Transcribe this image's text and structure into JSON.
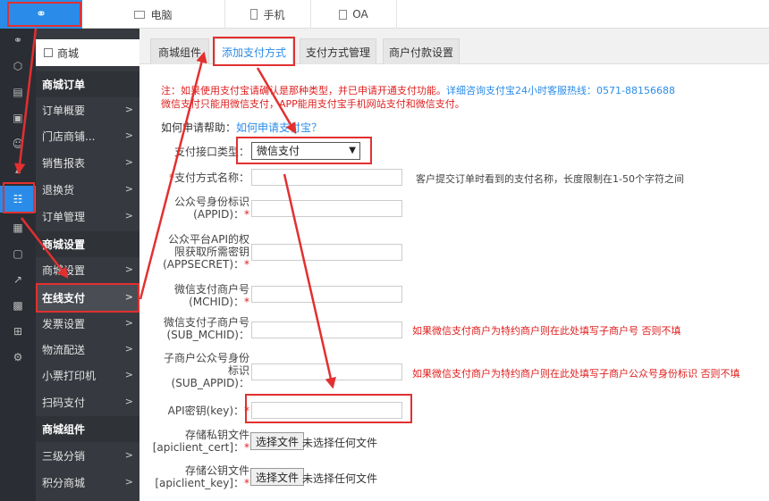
{
  "topbar": {
    "logo_glyph": "&#8734;",
    "tabs": [
      {
        "label": "电脑",
        "icon": "monitor-icon"
      },
      {
        "label": "手机",
        "icon": "phone-icon"
      },
      {
        "label": "OA",
        "icon": "document-icon"
      }
    ]
  },
  "rail": {
    "icons": [
      "link-icon",
      "cube-icon",
      "document-icon",
      "image-icon",
      "user-icon",
      "chart-icon",
      "clipboard-icon",
      "shop-icon",
      "briefcase-icon",
      "trend-icon",
      "id-card-icon",
      "grid-icon",
      "gear-icon"
    ]
  },
  "menu": {
    "store": "商城",
    "sections": [
      {
        "header": "商城订单",
        "items": [
          "订单概要",
          "门店商铺...",
          "销售报表",
          "退换货",
          "订单管理"
        ]
      },
      {
        "header": "商城设置",
        "items": [
          "商城设置",
          "在线支付",
          "发票设置",
          "物流配送",
          "小票打印机",
          "扫码支付"
        ]
      },
      {
        "header": "商城组件",
        "items": [
          "三级分销",
          "积分商城"
        ]
      }
    ]
  },
  "tabs": [
    "商城组件",
    "添加支付方式",
    "支付方式管理",
    "商户付款设置"
  ],
  "notice": {
    "line1_red": "注：如果使用支付宝请确认是那种类型，并已申请开通支付功能。",
    "line1_blue": "详细咨询支付宝24小时客服热线：0571-88156688",
    "line2": "微信支付只能用微信支付，APP能用支付宝手机网站支付和微信支付。"
  },
  "help": {
    "label": "如何申请帮助：",
    "link": "如何申请支付宝？"
  },
  "form": {
    "type_label": "支付接口类型：",
    "type_value": "微信支付",
    "name_label": "支付方式名称：",
    "name_hint": "客户提交订单时看到的支付名称，长度限制在1-50个字符之间",
    "appid_label1": "公众号身份标识",
    "appid_label2": "(APPID)：",
    "secret_label1": "公众平台API的权",
    "secret_label2": "限获取所需密钥",
    "secret_label3": "(APPSECRET)：",
    "mchid_label1": "微信支付商户号",
    "mchid_label2": "(MCHID)：",
    "sub_mchid_label1": "微信支付子商户号",
    "sub_mchid_label2": "(SUB_MCHID)：",
    "sub_mchid_hint": "如果微信支付商户为特约商户则在此处填写子商户号 否则不填",
    "sub_appid_label1": "子商户公众号身份",
    "sub_appid_label2": "标识",
    "sub_appid_label3": "(SUB_APPID)：",
    "sub_appid_hint": "如果微信支付商户为特约商户则在此处填写子商户公众号身份标识 否则不填",
    "key_label": "API密钥(key)：",
    "cert_label1": "存储私钥文件",
    "cert_label2": "[apiclient_cert]：",
    "keyfile_label1": "存储公钥文件",
    "keyfile_label2": "[apiclient_key]：",
    "file_button": "选择文件",
    "file_none": "未选择任何文件",
    "required_mark": "*"
  },
  "colors": {
    "accent": "#2a8ce8",
    "annotation": "#e23030",
    "sidebar": "#36393f",
    "rail": "#2a2d33"
  }
}
